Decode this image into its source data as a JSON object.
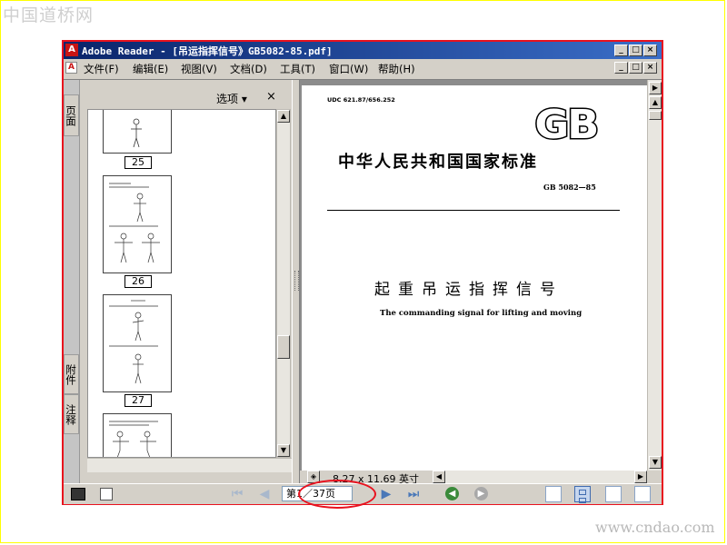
{
  "watermarks": {
    "top": "中国道桥网",
    "bottom": "www.cndao.com"
  },
  "window": {
    "title": "Adobe Reader - [吊运指挥信号》GB5082-85.pdf]",
    "controls": {
      "minimize": "_",
      "maximize": "□",
      "close": "×"
    }
  },
  "menu": {
    "items": [
      "文件(F)",
      "编辑(E)",
      "视图(V)",
      "文档(D)",
      "工具(T)",
      "窗口(W)",
      "帮助(H)"
    ]
  },
  "side_tabs": [
    "页面",
    "附件",
    "注释"
  ],
  "left_panel": {
    "options_label": "选项 ▾",
    "close_label": "×",
    "page_labels": [
      "25",
      "26",
      "27"
    ]
  },
  "document": {
    "udc": "UDC 621.87/656.252",
    "logo": "GB",
    "standard_title": "中华人民共和国国家标准",
    "standard_number": "GB 5082—85",
    "chinese_title": "起重吊运指挥信号",
    "english_title": "The commanding signal for lifting and moving",
    "page_size": "8.27 x 11.69 英寸"
  },
  "navigation": {
    "page_display": "第1／37页"
  },
  "colors": {
    "annotation": "#e8121e",
    "titlebar": "#0a246a",
    "nav_green": "#3a8a3a"
  }
}
